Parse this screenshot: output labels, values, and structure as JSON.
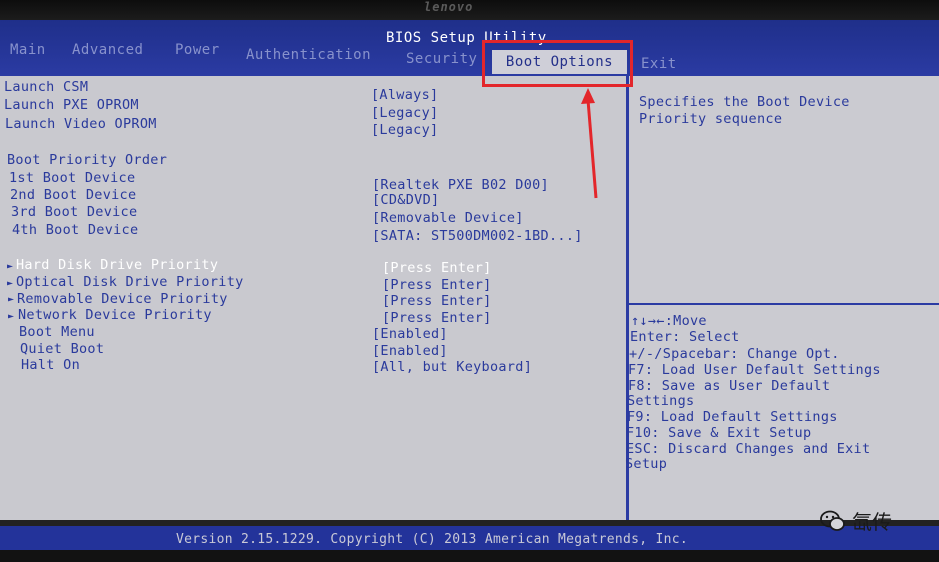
{
  "bezel": {
    "logo": "lenovo"
  },
  "header": {
    "title": "BIOS Setup Utility",
    "tabs": [
      {
        "label": "Main"
      },
      {
        "label": "Advanced"
      },
      {
        "label": "Power"
      },
      {
        "label": "Authentication"
      },
      {
        "label": "Security"
      },
      {
        "label": "Boot Options",
        "active": true
      },
      {
        "label": "Exit"
      }
    ]
  },
  "settings": {
    "launch_csm": {
      "label": "Launch CSM",
      "value": "[Always]"
    },
    "launch_pxe": {
      "label": "Launch PXE OPROM",
      "value": "[Legacy]"
    },
    "launch_video": {
      "label": "Launch Video OPROM",
      "value": "[Legacy]"
    },
    "boot_priority_heading": "Boot Priority Order",
    "boot_devices": [
      {
        "label": "1st Boot Device",
        "value": "[Realtek PXE B02 D00]"
      },
      {
        "label": "2nd Boot Device",
        "value": "[CD&DVD]"
      },
      {
        "label": "3rd Boot Device",
        "value": "[Removable Device]"
      },
      {
        "label": "4th Boot Device",
        "value": "[SATA: ST500DM002-1BD...]"
      }
    ],
    "priorities": [
      {
        "label": "Hard Disk Drive Priority",
        "value": "[Press Enter]",
        "selected": true
      },
      {
        "label": "Optical Disk Drive Priority",
        "value": "[Press Enter]"
      },
      {
        "label": "Removable Device Priority",
        "value": "[Press Enter]"
      },
      {
        "label": "Network Device Priority",
        "value": "[Press Enter]"
      }
    ],
    "boot_menu": {
      "label": "Boot Menu",
      "value": "[Enabled]"
    },
    "quiet_boot": {
      "label": "Quiet Boot",
      "value": "[Enabled]"
    },
    "halt_on": {
      "label": "Halt On",
      "value": "[All, but Keyboard]"
    }
  },
  "help": {
    "description": [
      "Specifies the Boot Device",
      "Priority sequence"
    ],
    "keys": [
      "↑↓→←:Move",
      "Enter: Select",
      "+/-/Spacebar: Change Opt.",
      "F7: Load User Default Settings",
      "F8: Save as User Default",
      "Settings",
      "F9: Load Default Settings",
      "F10: Save & Exit Setup",
      "ESC: Discard Changes and Exit",
      "Setup"
    ]
  },
  "footer": {
    "text": "Version 2.15.1229. Copyright (C) 2013 American Megatrends, Inc."
  },
  "watermark": {
    "text": "氙传"
  },
  "colors": {
    "header_blue": "#2b3ba3",
    "panel_gray": "#c9c9cf",
    "text_blue": "#2a3a9c",
    "annotation_red": "#e3262b"
  }
}
